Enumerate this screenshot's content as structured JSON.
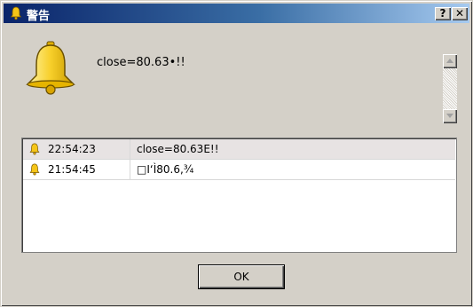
{
  "window": {
    "title": "警告",
    "help_label": "?",
    "close_label": "✕"
  },
  "alert": {
    "message": "close=80.63•!!"
  },
  "log": {
    "rows": [
      {
        "time": "22:54:23",
        "text": "close=80.63E!!"
      },
      {
        "time": "21:54:45",
        "text": "□I‘Ì80.6,¾"
      }
    ]
  },
  "buttons": {
    "ok_label": "OK"
  },
  "colors": {
    "title_gradient_start": "#0a246a",
    "title_gradient_end": "#a6caf0",
    "face": "#d4d0c8",
    "bell": "#f5c518",
    "selected_row": "#e7e3e3"
  },
  "icons": {
    "title": "bell-icon",
    "alert": "bell-icon",
    "row": "bell-icon"
  }
}
